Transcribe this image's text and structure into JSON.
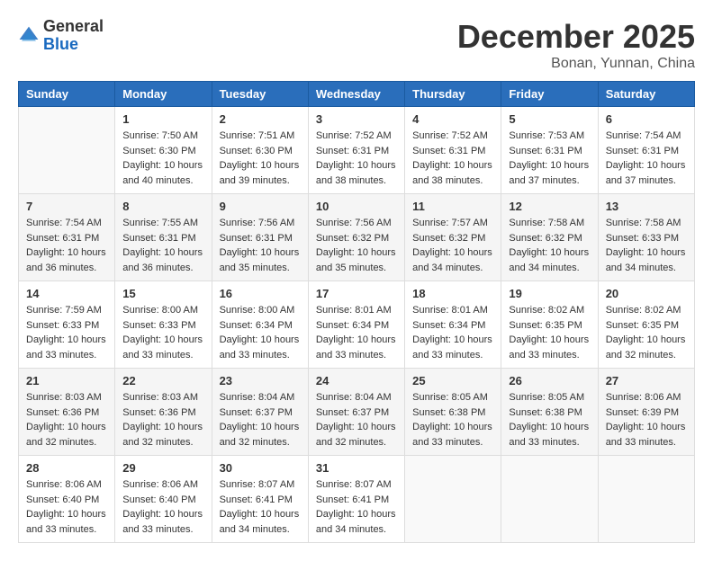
{
  "logo": {
    "general": "General",
    "blue": "Blue"
  },
  "title": {
    "month": "December 2025",
    "location": "Bonan, Yunnan, China"
  },
  "weekdays": [
    "Sunday",
    "Monday",
    "Tuesday",
    "Wednesday",
    "Thursday",
    "Friday",
    "Saturday"
  ],
  "weeks": [
    [
      {
        "day": "",
        "info": ""
      },
      {
        "day": "1",
        "info": "Sunrise: 7:50 AM\nSunset: 6:30 PM\nDaylight: 10 hours\nand 40 minutes."
      },
      {
        "day": "2",
        "info": "Sunrise: 7:51 AM\nSunset: 6:30 PM\nDaylight: 10 hours\nand 39 minutes."
      },
      {
        "day": "3",
        "info": "Sunrise: 7:52 AM\nSunset: 6:31 PM\nDaylight: 10 hours\nand 38 minutes."
      },
      {
        "day": "4",
        "info": "Sunrise: 7:52 AM\nSunset: 6:31 PM\nDaylight: 10 hours\nand 38 minutes."
      },
      {
        "day": "5",
        "info": "Sunrise: 7:53 AM\nSunset: 6:31 PM\nDaylight: 10 hours\nand 37 minutes."
      },
      {
        "day": "6",
        "info": "Sunrise: 7:54 AM\nSunset: 6:31 PM\nDaylight: 10 hours\nand 37 minutes."
      }
    ],
    [
      {
        "day": "7",
        "info": "Sunrise: 7:54 AM\nSunset: 6:31 PM\nDaylight: 10 hours\nand 36 minutes."
      },
      {
        "day": "8",
        "info": "Sunrise: 7:55 AM\nSunset: 6:31 PM\nDaylight: 10 hours\nand 36 minutes."
      },
      {
        "day": "9",
        "info": "Sunrise: 7:56 AM\nSunset: 6:31 PM\nDaylight: 10 hours\nand 35 minutes."
      },
      {
        "day": "10",
        "info": "Sunrise: 7:56 AM\nSunset: 6:32 PM\nDaylight: 10 hours\nand 35 minutes."
      },
      {
        "day": "11",
        "info": "Sunrise: 7:57 AM\nSunset: 6:32 PM\nDaylight: 10 hours\nand 34 minutes."
      },
      {
        "day": "12",
        "info": "Sunrise: 7:58 AM\nSunset: 6:32 PM\nDaylight: 10 hours\nand 34 minutes."
      },
      {
        "day": "13",
        "info": "Sunrise: 7:58 AM\nSunset: 6:33 PM\nDaylight: 10 hours\nand 34 minutes."
      }
    ],
    [
      {
        "day": "14",
        "info": "Sunrise: 7:59 AM\nSunset: 6:33 PM\nDaylight: 10 hours\nand 33 minutes."
      },
      {
        "day": "15",
        "info": "Sunrise: 8:00 AM\nSunset: 6:33 PM\nDaylight: 10 hours\nand 33 minutes."
      },
      {
        "day": "16",
        "info": "Sunrise: 8:00 AM\nSunset: 6:34 PM\nDaylight: 10 hours\nand 33 minutes."
      },
      {
        "day": "17",
        "info": "Sunrise: 8:01 AM\nSunset: 6:34 PM\nDaylight: 10 hours\nand 33 minutes."
      },
      {
        "day": "18",
        "info": "Sunrise: 8:01 AM\nSunset: 6:34 PM\nDaylight: 10 hours\nand 33 minutes."
      },
      {
        "day": "19",
        "info": "Sunrise: 8:02 AM\nSunset: 6:35 PM\nDaylight: 10 hours\nand 33 minutes."
      },
      {
        "day": "20",
        "info": "Sunrise: 8:02 AM\nSunset: 6:35 PM\nDaylight: 10 hours\nand 32 minutes."
      }
    ],
    [
      {
        "day": "21",
        "info": "Sunrise: 8:03 AM\nSunset: 6:36 PM\nDaylight: 10 hours\nand 32 minutes."
      },
      {
        "day": "22",
        "info": "Sunrise: 8:03 AM\nSunset: 6:36 PM\nDaylight: 10 hours\nand 32 minutes."
      },
      {
        "day": "23",
        "info": "Sunrise: 8:04 AM\nSunset: 6:37 PM\nDaylight: 10 hours\nand 32 minutes."
      },
      {
        "day": "24",
        "info": "Sunrise: 8:04 AM\nSunset: 6:37 PM\nDaylight: 10 hours\nand 32 minutes."
      },
      {
        "day": "25",
        "info": "Sunrise: 8:05 AM\nSunset: 6:38 PM\nDaylight: 10 hours\nand 33 minutes."
      },
      {
        "day": "26",
        "info": "Sunrise: 8:05 AM\nSunset: 6:38 PM\nDaylight: 10 hours\nand 33 minutes."
      },
      {
        "day": "27",
        "info": "Sunrise: 8:06 AM\nSunset: 6:39 PM\nDaylight: 10 hours\nand 33 minutes."
      }
    ],
    [
      {
        "day": "28",
        "info": "Sunrise: 8:06 AM\nSunset: 6:40 PM\nDaylight: 10 hours\nand 33 minutes."
      },
      {
        "day": "29",
        "info": "Sunrise: 8:06 AM\nSunset: 6:40 PM\nDaylight: 10 hours\nand 33 minutes."
      },
      {
        "day": "30",
        "info": "Sunrise: 8:07 AM\nSunset: 6:41 PM\nDaylight: 10 hours\nand 34 minutes."
      },
      {
        "day": "31",
        "info": "Sunrise: 8:07 AM\nSunset: 6:41 PM\nDaylight: 10 hours\nand 34 minutes."
      },
      {
        "day": "",
        "info": ""
      },
      {
        "day": "",
        "info": ""
      },
      {
        "day": "",
        "info": ""
      }
    ]
  ]
}
